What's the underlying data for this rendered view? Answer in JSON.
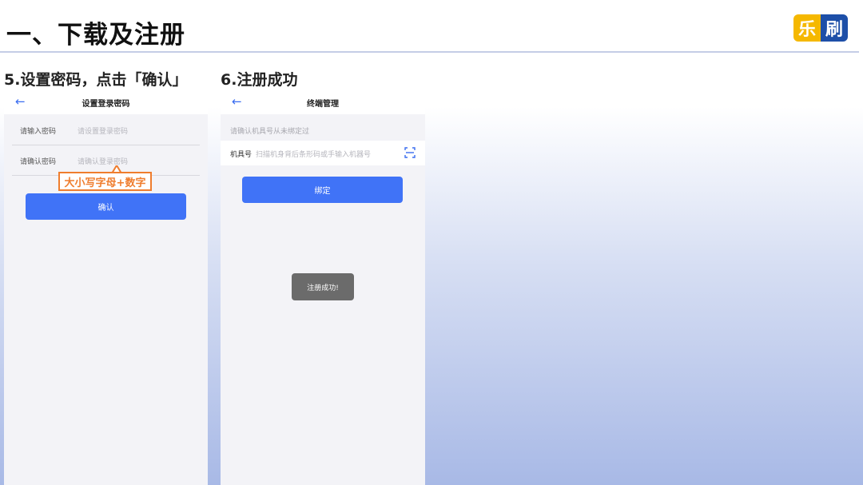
{
  "slide": {
    "title": "一、下载及注册",
    "logo_left": "乐",
    "logo_right": "刷"
  },
  "step5": {
    "heading": "5.设置密码，点击「确认」",
    "nav_title": "设置登录密码",
    "rows": [
      {
        "label": "请输入密码",
        "placeholder": "请设置登录密码"
      },
      {
        "label": "请确认密码",
        "placeholder": "请确认登录密码"
      }
    ],
    "annotation": "大小写字母+数字",
    "button": "确认"
  },
  "step6": {
    "heading": "6.注册成功",
    "nav_title": "终端管理",
    "info": "请确认机具号从未绑定过",
    "terminal_label": "机具号",
    "terminal_placeholder": "扫描机身背后条形码或手输入机器号",
    "button": "绑定",
    "toast": "注册成功!"
  },
  "icons": {
    "back": "arrow-left-icon",
    "scan": "scan-icon"
  },
  "colors": {
    "accent": "#4073f7",
    "annotation": "#ef7d2e",
    "logo_yellow": "#f5b800",
    "logo_blue": "#1d4fa8"
  }
}
